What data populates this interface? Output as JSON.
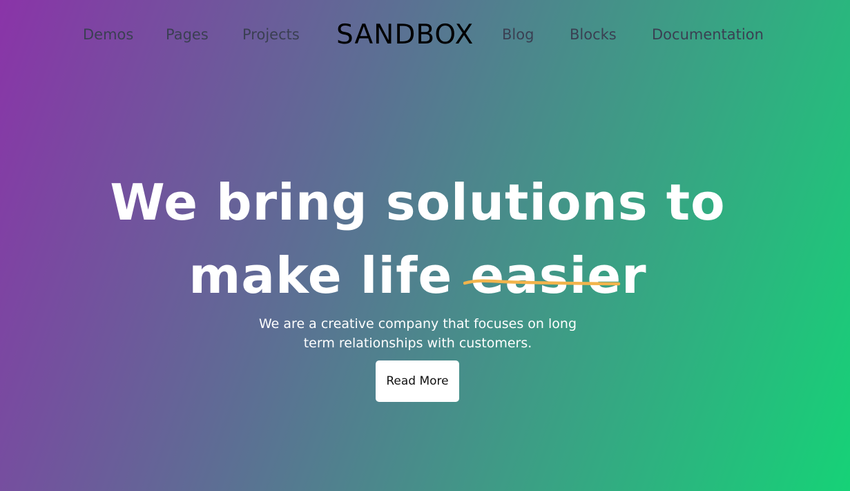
{
  "nav": {
    "items_left": [
      {
        "label": "Demos"
      },
      {
        "label": "Pages"
      },
      {
        "label": "Projects"
      }
    ],
    "logo": "SANDBOX",
    "items_right": [
      {
        "label": "Blog"
      },
      {
        "label": "Blocks"
      },
      {
        "label": "Documentation"
      }
    ]
  },
  "hero": {
    "title_line1": "We bring solutions to",
    "title_line2_prefix": "make life ",
    "title_highlight": "easier",
    "subtitle": "We are a creative company that focuses on long term relationships with customers.",
    "cta_label": "Read More"
  },
  "colors": {
    "gradient_start": "#8a34a8",
    "gradient_end": "#16d277",
    "underline": "#f2b44c",
    "nav_text": "#3a3f52",
    "title_text": "#ffffff"
  }
}
